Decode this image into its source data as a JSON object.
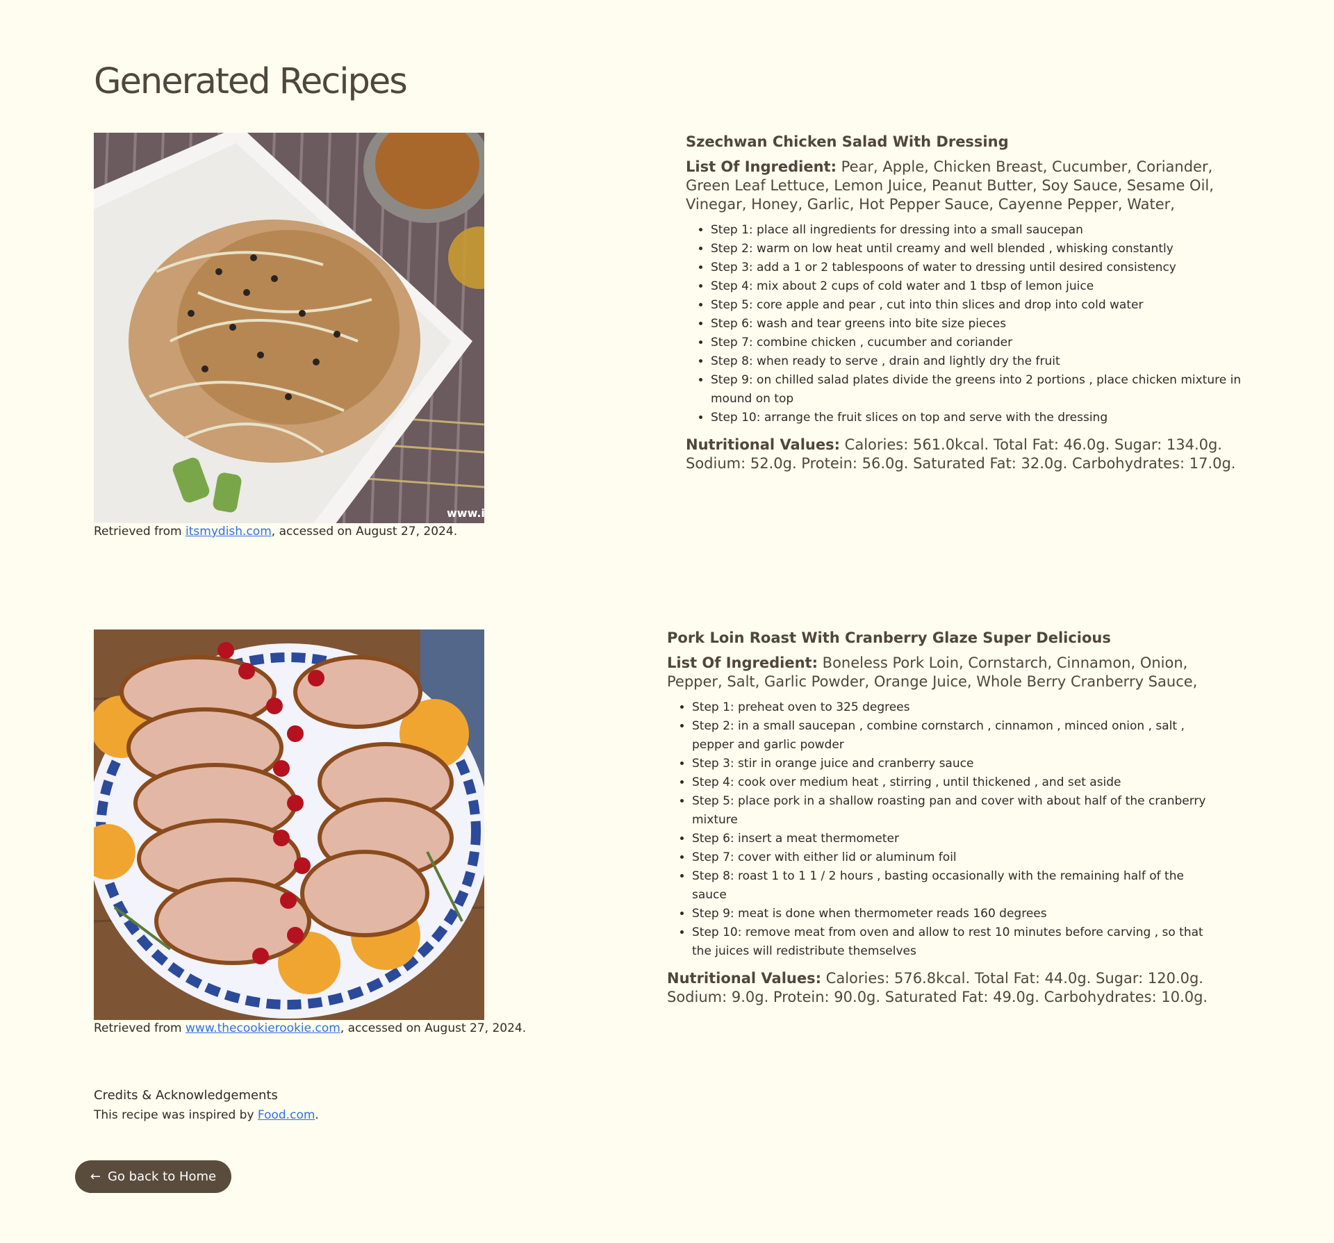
{
  "page": {
    "title": "Generated Recipes"
  },
  "recipes": [
    {
      "image_description_icon": "salad-photo",
      "caption_prefix": "Retrieved from",
      "caption_link": "itsmydish.com",
      "caption_suffix": ", accessed on August 27, 2024.",
      "title": "Szechwan Chicken Salad With Dressing",
      "ingredients_label": "List Of Ingredient:",
      "ingredients": "Pear, Apple, Chicken Breast, Cucumber, Coriander, Green Leaf Lettuce, Lemon Juice, Peanut Butter, Soy Sauce, Sesame Oil, Vinegar, Honey, Garlic, Hot Pepper Sauce, Cayenne Pepper, Water,",
      "steps": [
        "Step 1: place all ingredients for dressing into a small saucepan",
        "Step 2: warm on low heat until creamy and well blended , whisking constantly",
        "Step 3: add a 1 or 2 tablespoons of water to dressing until desired consistency",
        "Step 4: mix about 2 cups of cold water and 1 tbsp of lemon juice",
        "Step 5: core apple and pear , cut into thin slices and drop into cold water",
        "Step 6: wash and tear greens into bite size pieces",
        "Step 7: combine chicken , cucumber and coriander",
        "Step 8: when ready to serve , drain and lightly dry the fruit",
        "Step 9: on chilled salad plates divide the greens into 2 portions , place chicken mixture in mound on top",
        "Step 10: arrange the fruit slices on top and serve with the dressing"
      ],
      "nutrition_label": "Nutritional Values:",
      "nutrition": "Calories: 561.0kcal. Total Fat: 46.0g. Sugar: 134.0g. Sodium: 52.0g. Protein: 56.0g. Saturated Fat: 32.0g. Carbohydrates: 17.0g.",
      "watermark": "www.i"
    },
    {
      "image_description_icon": "pork-roast-photo",
      "caption_prefix": "Retrieved from",
      "caption_link": "www.thecookierookie.com",
      "caption_suffix": ", accessed on August 27, 2024.",
      "title": "Pork Loin Roast With Cranberry Glaze Super Delicious",
      "ingredients_label": "List Of Ingredient:",
      "ingredients": "Boneless Pork Loin, Cornstarch, Cinnamon, Onion, Pepper, Salt, Garlic Powder, Orange Juice, Whole Berry Cranberry Sauce,",
      "steps": [
        "Step 1: preheat oven to 325 degrees",
        "Step 2: in a small saucepan , combine cornstarch , cinnamon , minced onion , salt , pepper and garlic powder",
        "Step 3: stir in orange juice and cranberry sauce",
        "Step 4: cook over medium heat , stirring , until thickened , and set aside",
        "Step 5: place pork in a shallow roasting pan and cover with about half of the cranberry mixture",
        "Step 6: insert a meat thermometer",
        "Step 7: cover with either lid or aluminum foil",
        "Step 8: roast 1 to 1 1 / 2 hours , basting occasionally with the remaining half of the sauce",
        "Step 9: meat is done when thermometer reads 160 degrees",
        "Step 10: remove meat from oven and allow to rest 10 minutes before carving , so that the juices will redistribute themselves"
      ],
      "nutrition_label": "Nutritional Values:",
      "nutrition": "Calories: 576.8kcal. Total Fat: 44.0g. Sugar: 120.0g. Sodium: 9.0g. Protein: 90.0g. Saturated Fat: 49.0g. Carbohydrates: 10.0g."
    }
  ],
  "credits": {
    "title": "Credits & Acknowledgements",
    "text_prefix": "This recipe was inspired by",
    "link": "Food.com",
    "text_suffix": "."
  },
  "home_button": {
    "arrow": "←",
    "label": "Go back to Home",
    "icon": "arrow-left-icon"
  },
  "colors": {
    "background": "#fffdf0",
    "text": "#4f463c",
    "link": "#2f6fe3",
    "button": "#5a4c3d"
  }
}
